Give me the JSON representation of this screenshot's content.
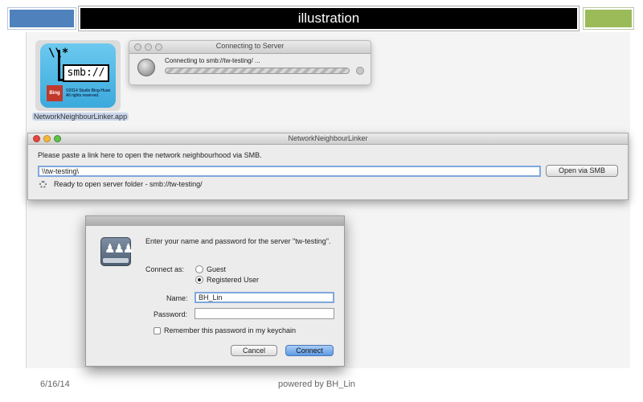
{
  "slide": {
    "title": "illustration",
    "footer_date": "6/16/14",
    "footer_credit": "powered by BH_Lin",
    "colors": {
      "left_block": "#4f81bd",
      "title_bg": "#000000",
      "right_block": "#9bbb59"
    }
  },
  "app_icon": {
    "icon": "smb-app-icon",
    "backslash_text": "\\\\*",
    "smb_text": "smb://",
    "brand_text": "Bing",
    "copyright_text": "©2014 Studio Bing-Huan All rights reserved.",
    "label": "NetworkNeighbourLinker.app"
  },
  "connecting_window": {
    "title": "Connecting to Server",
    "message": "Connecting to smb://tw-testing/ ...",
    "icon": "globe-icon"
  },
  "nnl_window": {
    "title": "NetworkNeighbourLinker",
    "prompt": "Please paste a link here to open the network neighbourhood via SMB.",
    "link_value": "\\\\tw-testing\\",
    "open_button": "Open via SMB",
    "status": "Ready to open server folder - smb://tw-testing/"
  },
  "login_dialog": {
    "heading": "Enter your name and password for the server \"tw-testing\".",
    "connect_as_label": "Connect as:",
    "options": [
      "Guest",
      "Registered User"
    ],
    "selected_option": "Registered User",
    "name_label": "Name:",
    "name_value": "BH_Lin",
    "password_label": "Password:",
    "password_value": "",
    "remember_label": "Remember this password in my keychain",
    "cancel_button": "Cancel",
    "connect_button": "Connect",
    "accent_color": "#5d9ae6"
  }
}
